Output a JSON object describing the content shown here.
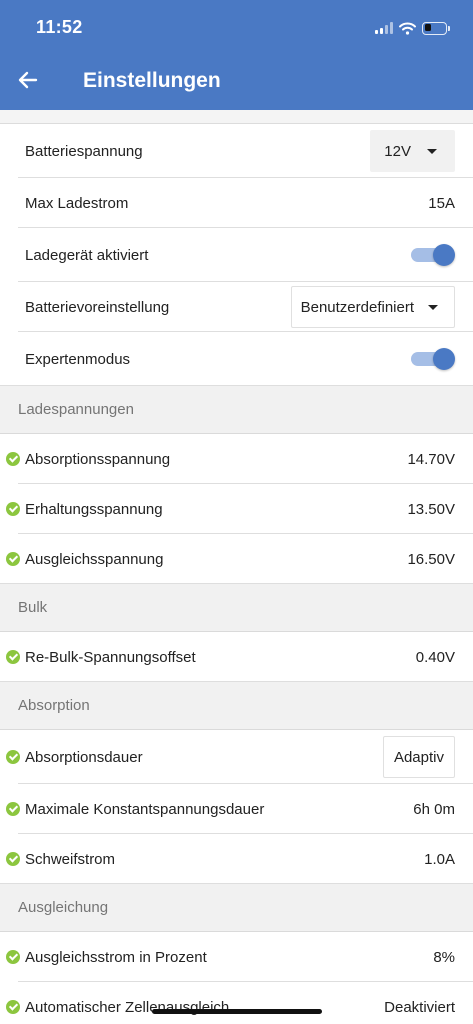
{
  "status_bar": {
    "time": "11:52",
    "icons": [
      "cellular-signal-icon",
      "wifi-icon",
      "battery-icon"
    ]
  },
  "header": {
    "title": "Einstellungen",
    "back_icon": "arrow-left-icon"
  },
  "colors": {
    "header": "#4a79c4",
    "toggle_on": "#4a79c4",
    "check": "#8cc63f"
  },
  "general": [
    {
      "label": "Batteriespannung",
      "control": "dropdown",
      "value": "12V"
    },
    {
      "label": "Max Ladestrom",
      "value": "15A"
    },
    {
      "label": "Ladegerät aktiviert",
      "control": "toggle",
      "on": true
    },
    {
      "label": "Batterievoreinstellung",
      "control": "dropdown",
      "value": "Benutzerdefiniert"
    },
    {
      "label": "Expertenmodus",
      "control": "toggle",
      "on": true
    }
  ],
  "sections": {
    "ladespannungen": {
      "title": "Ladespannungen",
      "rows": [
        {
          "label": "Absorptionsspannung",
          "value": "14.70V"
        },
        {
          "label": "Erhaltungsspannung",
          "value": "13.50V"
        },
        {
          "label": "Ausgleichsspannung",
          "value": "16.50V"
        }
      ]
    },
    "bulk": {
      "title": "Bulk",
      "rows": [
        {
          "label": "Re-Bulk-Spannungsoffset",
          "value": "0.40V"
        }
      ]
    },
    "absorption": {
      "title": "Absorption",
      "rows": [
        {
          "label": "Absorptionsdauer",
          "value": "Adaptiv"
        },
        {
          "label": "Maximale Konstantspannungsdauer",
          "value": "6h 0m"
        },
        {
          "label": "Schweifstrom",
          "value": "1.0A"
        }
      ]
    },
    "ausgleichung": {
      "title": "Ausgleichung",
      "rows": [
        {
          "label": "Ausgleichsstrom in Prozent",
          "value": "8%"
        },
        {
          "label": "Automatischer Zellenausgleich",
          "value": "Deaktiviert"
        }
      ]
    }
  }
}
